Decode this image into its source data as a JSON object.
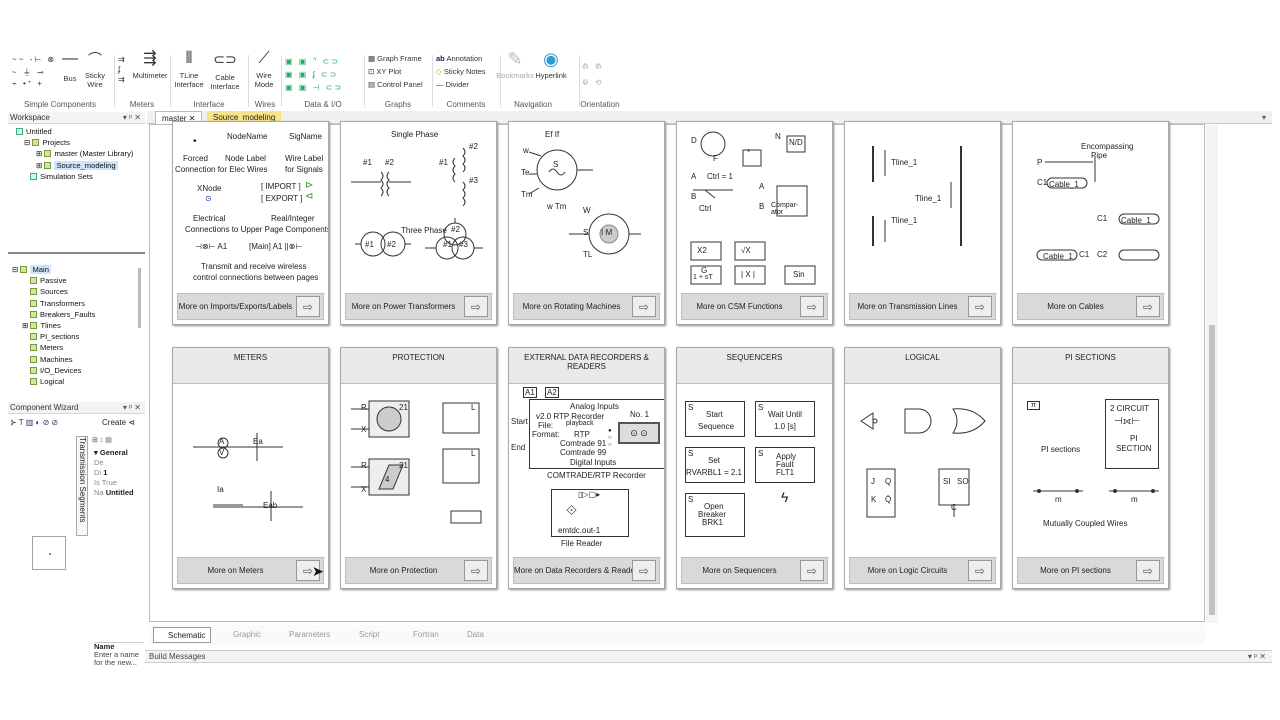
{
  "ribbon": {
    "groups": [
      {
        "label": "Simple Components",
        "buttons": [
          "Bus",
          "Sticky Wire"
        ]
      },
      {
        "label": "Meters",
        "buttons": [
          "Multimeter"
        ]
      },
      {
        "label": "Interface",
        "buttons": [
          "TLine Interface",
          "Cable Interface"
        ]
      },
      {
        "label": "Wires",
        "buttons": [
          "Wire Mode"
        ]
      },
      {
        "label": "Data & I/O",
        "buttons": []
      },
      {
        "label": "Graphs",
        "buttons": [
          "Graph Frame",
          "XY Plot",
          "Control Panel"
        ]
      },
      {
        "label": "Comments",
        "buttons": [
          "Annotation",
          "Sticky Notes",
          "Divider"
        ]
      },
      {
        "label": "Navigation",
        "buttons": [
          "Bookmarks",
          "Hyperlink"
        ]
      },
      {
        "label": "Orientation",
        "buttons": []
      }
    ],
    "tline_top": "TLine",
    "tline_bot": "Interface",
    "cable_top": "Cable",
    "cable_bot": "Interface",
    "wire_top": "Wire",
    "wire_bot": "Mode",
    "sticky_top": "Sticky",
    "sticky_bot": "Wire"
  },
  "workspace": {
    "title": "Workspace",
    "tree": [
      "Untitled",
      "Projects",
      "master (Master Library)",
      "Source_modeling",
      "Simulation Sets"
    ]
  },
  "definitions": {
    "root": "Main",
    "items": [
      "Passive",
      "Sources",
      "Transformers",
      "Breakers_Faults",
      "Tlines",
      "PI_sections",
      "Meters",
      "Machines",
      "I/O_Devices",
      "Logical"
    ]
  },
  "wizard": {
    "title": "Component Wizard",
    "create": "Create",
    "vertical_label": "Transmission Segments",
    "general": "General",
    "props": [
      [
        "De",
        ""
      ],
      [
        "Di",
        "1"
      ],
      [
        "Is",
        "True"
      ],
      [
        "Na",
        "Untitled"
      ]
    ],
    "name_label": "Name",
    "name_hint": "Enter a name for the new..."
  },
  "doc_tabs": [
    "master",
    "Source_modeling"
  ],
  "cards_top": [
    {
      "footer": "More on Imports/Exports/Labels"
    },
    {
      "footer": "More on Power Transformers"
    },
    {
      "footer": "More on Rotating Machines"
    },
    {
      "footer": "More on CSM Functions"
    },
    {
      "footer": "More on Transmission Lines"
    },
    {
      "footer": "More on Cables"
    }
  ],
  "cards_bottom": [
    {
      "title": "METERS",
      "footer": "More on Meters"
    },
    {
      "title": "PROTECTION",
      "footer": "More on Protection"
    },
    {
      "title": "EXTERNAL DATA RECORDERS & READERS",
      "footer": "More on Data Recorders & Readers"
    },
    {
      "title": "SEQUENCERS",
      "footer": "More on Sequencers"
    },
    {
      "title": "LOGICAL",
      "footer": "More on Logic Circuits"
    },
    {
      "title": "PI SECTIONS",
      "footer": "More on PI sections"
    }
  ],
  "labels": {
    "imp": {
      "nodename": "NodeName",
      "signame": "SigName",
      "forced": "Forced",
      "conn_elec": "Connection for Elec Wires",
      "node_label": "Node Label",
      "wire_label": "Wire Label",
      "for_signals": "for Signals",
      "xnode": "XNode",
      "import": "[ IMPORT ]",
      "export": "[ EXPORT ]",
      "electrical": "Electrical",
      "real_int": "Real/Integer",
      "conn_upper": "Connections to Upper Page Components",
      "a1": "A1",
      "main_a1": "[Main] A1",
      "transmit1": "Transmit and receive wireless",
      "transmit2": "control connections between pages"
    },
    "xfmr": {
      "single": "Single Phase",
      "three": "Three Phase",
      "n1": "#1",
      "n2": "#2",
      "n3": "#3"
    },
    "mach": {
      "ef": "Ef",
      "if": "If",
      "w": "w",
      "te": "Te",
      "tm": "Tm",
      "s": "S",
      "wtm": "w Tm",
      "im": "I M",
      "tl": "TL",
      "w2": "W"
    },
    "csm": {
      "d": "D",
      "f": "F",
      "n": "N",
      "nd": "N/D",
      "ctrl1": "Ctrl =  1",
      "a": "A",
      "b": "B",
      "ctrl": "Ctrl",
      "comp": "Compar-ator",
      "x2": "X2",
      "sqrt": "√X",
      "g": "G",
      "gs": "1 + sT",
      "abs": "| X |",
      "sin": "Sin"
    },
    "tline": {
      "t1": "Tline_1",
      "t2": "Tline_1",
      "t3": "Tline_1"
    },
    "cables": {
      "pipe1": "Encompassing",
      "pipe2": "Pipe",
      "p": "P",
      "c1": "C1",
      "cab": "Cable_1",
      "c2": "C2"
    },
    "meters": {
      "a": "A",
      "v": "V",
      "ea": "Ea",
      "ia": "Ia",
      "eab": "Eab"
    },
    "prot": {
      "r": "R",
      "x": "X",
      "n21": "21",
      "l": "L",
      "n4": "4"
    },
    "rec": {
      "a1": "A1",
      "a2": "A2",
      "analog": "Analog Inputs",
      "ver": "v2.0 RTP  Recorder",
      "no1": "No. 1",
      "file": "File:",
      "playback": "playback",
      "format": "Format:",
      "rtp": "RTP",
      "c91": "Comtrade 91",
      "c99": "Comtrade 99",
      "digital": "Digital Inputs",
      "start": "Start",
      "end": "End",
      "comtrade": "COMTRADE/RTP Recorder",
      "emtdc": "emtdc.out-1",
      "reader": "File Reader"
    },
    "seq": {
      "s": "S",
      "start": "Start",
      "sequence": "Sequence",
      "wait": "Wait Until",
      "wait_t": "1.0 [s]",
      "set": "Set",
      "rv": "RVARBL1 = 2.1",
      "apply": "Apply",
      "fault": "Fault",
      "flt1": "FLT1",
      "open": "Open",
      "breaker": "Breaker",
      "brk1": "BRK1"
    },
    "logic": {
      "j": "J",
      "q": "Q",
      "k": "K",
      "qb": "Q̄",
      "si": "SI",
      "so": "SO",
      "c": "C"
    },
    "pi": {
      "pi": "PI sections",
      "two": "2 CIRCUIT",
      "pisec": "PI",
      "section": "SECTION",
      "mutual": "Mutually Coupled Wires",
      "m": "m",
      "piicon": "π"
    }
  },
  "bottom_tabs": [
    "Schematic",
    "Graphic",
    "Parameters",
    "Script",
    "Fortran",
    "Data"
  ],
  "build_messages": "Build Messages"
}
